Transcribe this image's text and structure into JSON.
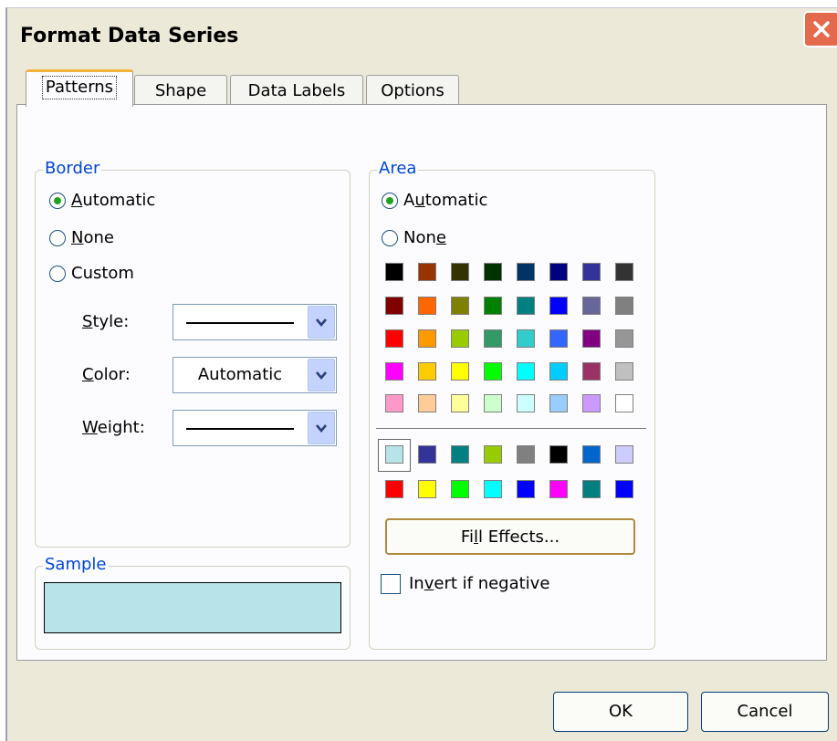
{
  "dialog": {
    "title": "Format Data Series",
    "close_icon": "close-icon"
  },
  "tabs": [
    {
      "label": "Patterns",
      "active": true
    },
    {
      "label": "Shape",
      "active": false
    },
    {
      "label": "Data Labels",
      "active": false
    },
    {
      "label": "Options",
      "active": false
    }
  ],
  "border": {
    "legend": "Border",
    "options": [
      {
        "pre": "",
        "mnemonic": "A",
        "post": "utomatic",
        "checked": true
      },
      {
        "pre": "",
        "mnemonic": "N",
        "post": "one",
        "checked": false
      },
      {
        "pre": "Custom",
        "mnemonic": "",
        "post": "",
        "checked": false
      }
    ],
    "style_label": {
      "pre": "",
      "mnemonic": "S",
      "post": "tyle:"
    },
    "color_label": {
      "pre": "",
      "mnemonic": "C",
      "post": "olor:"
    },
    "weight_label": {
      "pre": "",
      "mnemonic": "W",
      "post": "eight:"
    },
    "color_value": "Automatic"
  },
  "sample": {
    "legend": "Sample",
    "color": "#b7e4e8"
  },
  "area": {
    "legend": "Area",
    "options": [
      {
        "pre": "A",
        "mnemonic": "u",
        "post": "tomatic",
        "checked": true
      },
      {
        "pre": "Non",
        "mnemonic": "e",
        "post": "",
        "checked": false
      }
    ],
    "palette_main": [
      [
        "#000000",
        "#993300",
        "#333300",
        "#003300",
        "#003366",
        "#000080",
        "#333399",
        "#333333"
      ],
      [
        "#800000",
        "#ff6600",
        "#808000",
        "#008000",
        "#008080",
        "#0000ff",
        "#666699",
        "#808080"
      ],
      [
        "#ff0000",
        "#ff9900",
        "#99cc00",
        "#339966",
        "#33cccc",
        "#3366ff",
        "#800080",
        "#969696"
      ],
      [
        "#ff00ff",
        "#ffcc00",
        "#ffff00",
        "#00ff00",
        "#00ffff",
        "#00ccff",
        "#993366",
        "#c0c0c0"
      ],
      [
        "#ff99cc",
        "#ffcc99",
        "#ffff99",
        "#ccffcc",
        "#ccffff",
        "#99ccff",
        "#cc99ff",
        "#ffffff"
      ]
    ],
    "palette_chart": [
      [
        "#b7e4e8",
        "#333399",
        "#008080",
        "#99cc00",
        "#808080",
        "#000000",
        "#0066cc",
        "#ccccff"
      ],
      [
        "#ff0000",
        "#ffff00",
        "#00ff00",
        "#00ffff",
        "#0000ff",
        "#ff00ff",
        "#008080",
        "#0000ff"
      ]
    ],
    "fill_effects": {
      "pre": "Fi",
      "mnemonic": "l",
      "post": "l Effects..."
    },
    "invert": {
      "pre": "In",
      "mnemonic": "v",
      "post": "ert if negative",
      "checked": false
    }
  },
  "buttons": {
    "ok": "OK",
    "cancel": "Cancel"
  }
}
